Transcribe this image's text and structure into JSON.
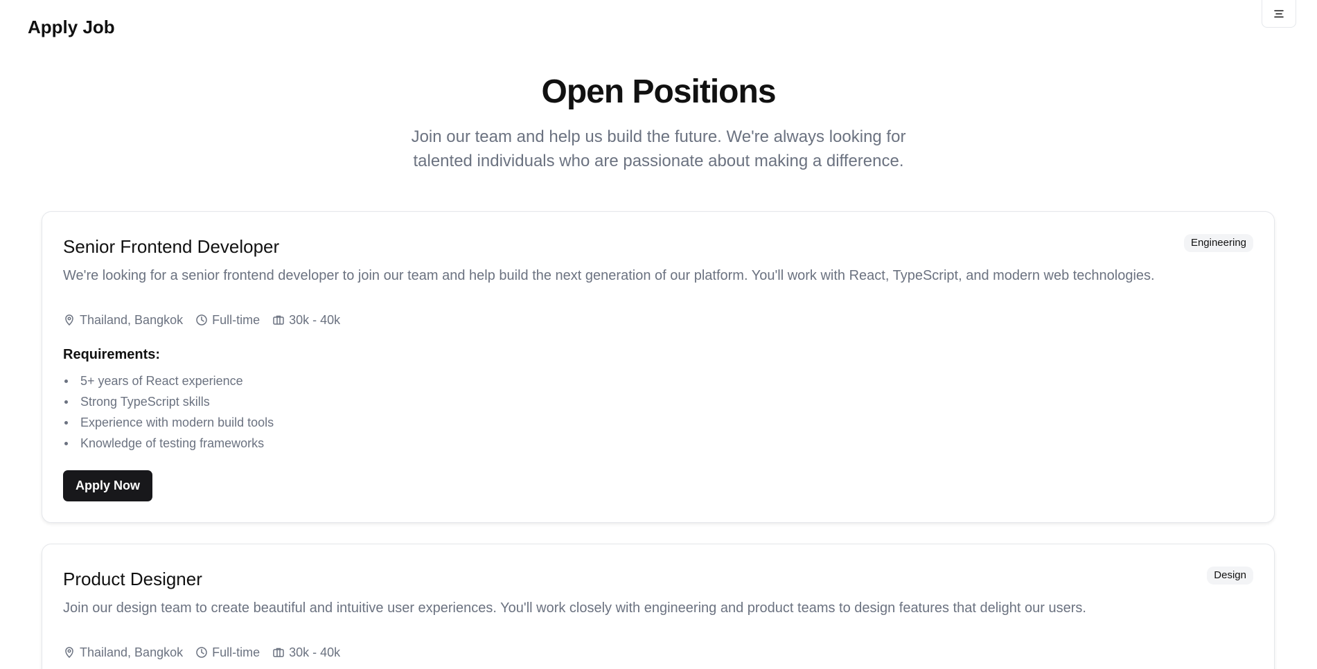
{
  "header": {
    "brand": "Apply Job",
    "menu_icon": "hamburger-icon"
  },
  "hero": {
    "title": "Open Positions",
    "subtitle": "Join our team and help us build the future. We're always looking for talented individuals who are passionate about making a difference."
  },
  "jobs": [
    {
      "title": "Senior Frontend Developer",
      "department": "Engineering",
      "description": "We're looking for a senior frontend developer to join our team and help build the next generation of our platform. You'll work with React, TypeScript, and modern web technologies.",
      "location": "Thailand, Bangkok",
      "employment_type": "Full-time",
      "salary": "30k - 40k",
      "requirements_title": "Requirements:",
      "requirements": [
        "5+ years of React experience",
        "Strong TypeScript skills",
        "Experience with modern build tools",
        "Knowledge of testing frameworks"
      ],
      "apply_label": "Apply Now"
    },
    {
      "title": "Product Designer",
      "department": "Design",
      "description": "Join our design team to create beautiful and intuitive user experiences. You'll work closely with engineering and product teams to design features that delight our users.",
      "location": "Thailand, Bangkok",
      "employment_type": "Full-time",
      "salary": "30k - 40k"
    }
  ],
  "icons": {
    "location": "location-pin-icon",
    "employment_type": "clock-icon",
    "salary": "briefcase-icon"
  },
  "colors": {
    "text": "#111111",
    "muted_text": "#6b7280",
    "border": "#e5e7eb",
    "button": "#18181b",
    "badge": "#f3f4f6"
  }
}
